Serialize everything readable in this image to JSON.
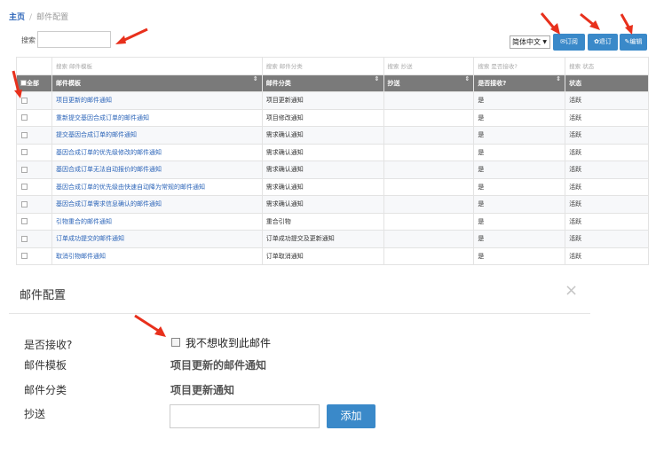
{
  "breadcrumb": {
    "home": "主页",
    "sep": "/",
    "current": "邮件配置"
  },
  "search": {
    "label": "搜索",
    "value": ""
  },
  "toolbar": {
    "language": "简体中文",
    "subscribe_label": "✉订阅",
    "unsubscribe_label": "✿退订",
    "edit_label": "✎编辑"
  },
  "table": {
    "filters": [
      "搜索 邮件模板",
      "搜索 邮件分类",
      "搜索 抄送",
      "搜索 是否接收?",
      "搜索 状态"
    ],
    "select_all": "全部",
    "headers": [
      "邮件模板",
      "邮件分类",
      "抄送",
      "是否接收?",
      "状态"
    ],
    "rows": [
      {
        "template": "项目更新的邮件通知",
        "category": "项目更新通知",
        "cc": "",
        "receive": "是",
        "status": "活跃"
      },
      {
        "template": "重新提交基因合成订单的邮件通知",
        "category": "项目修改通知",
        "cc": "",
        "receive": "是",
        "status": "活跃"
      },
      {
        "template": "提交基因合成订单的邮件通知",
        "category": "需求确认通知",
        "cc": "",
        "receive": "是",
        "status": "活跃"
      },
      {
        "template": "基因合成订单的优先级修改的邮件通知",
        "category": "需求确认通知",
        "cc": "",
        "receive": "是",
        "status": "活跃"
      },
      {
        "template": "基因合成订单无法自动报价的邮件通知",
        "category": "需求确认通知",
        "cc": "",
        "receive": "是",
        "status": "活跃"
      },
      {
        "template": "基因合成订单的优先级由快速自动降为常规的邮件通知",
        "category": "需求确认通知",
        "cc": "",
        "receive": "是",
        "status": "活跃"
      },
      {
        "template": "基因合成订单需求信息确认的邮件通知",
        "category": "需求确认通知",
        "cc": "",
        "receive": "是",
        "status": "活跃"
      },
      {
        "template": "引物重合的邮件通知",
        "category": "重合引物",
        "cc": "",
        "receive": "是",
        "status": "活跃"
      },
      {
        "template": "订单成功提交的邮件通知",
        "category": "订单成功提交及更新通知",
        "cc": "",
        "receive": "是",
        "status": "活跃"
      },
      {
        "template": "取消引物邮件通知",
        "category": "订单取消通知",
        "cc": "",
        "receive": "是",
        "status": "活跃"
      }
    ]
  },
  "modal": {
    "title": "邮件配置",
    "close": "×",
    "receive_label": "是否接收?",
    "receive_checkbox_label": "我不想收到此邮件",
    "template_label": "邮件模板",
    "template_value": "项目更新的邮件通知",
    "category_label": "邮件分类",
    "category_value": "项目更新通知",
    "cc_label": "抄送",
    "cc_value": "",
    "add_label": "添加"
  },
  "colors": {
    "accent": "#3a89c9",
    "link": "#2b64b8",
    "header_bg": "#7a7a7a",
    "arrow": "#e8301c"
  }
}
